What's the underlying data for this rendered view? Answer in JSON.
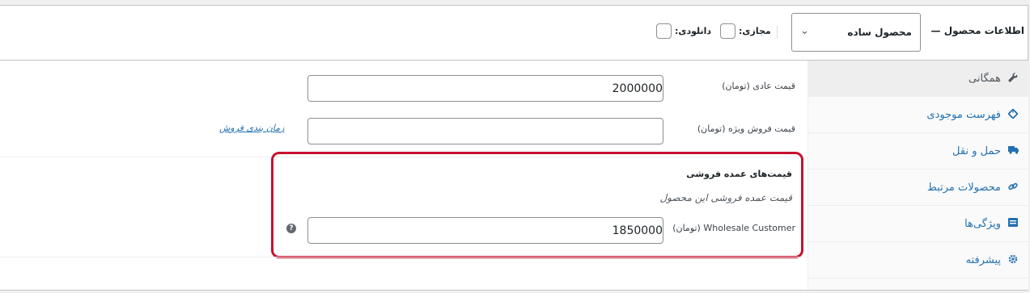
{
  "header": {
    "title": "اطلاعات محصول —",
    "product_type": "محصول ساده",
    "virtual_label": "مجازی:",
    "downloadable_label": "دانلودی:"
  },
  "tabs": [
    {
      "label": "همگانی",
      "icon": "wrench-icon",
      "active": true
    },
    {
      "label": "فهرست موجودی",
      "icon": "tag-icon",
      "active": false
    },
    {
      "label": "حمل و نقل",
      "icon": "truck-icon",
      "active": false
    },
    {
      "label": "محصولات مرتبط",
      "icon": "link-icon",
      "active": false
    },
    {
      "label": "ویژگی‌ها",
      "icon": "list-icon",
      "active": false
    },
    {
      "label": "پیشرفته",
      "icon": "gear-icon",
      "active": false
    }
  ],
  "general": {
    "regular_price_label": "قیمت عادی (تومان)",
    "regular_price_value": "2000000",
    "sale_price_label": "قیمت فروش ویژه (تومان)",
    "sale_price_value": "",
    "schedule_link": "زمان بندی فروش"
  },
  "wholesale": {
    "title": "قیمت‌های عمده فروشی",
    "description": "قیمت عمده فروشی این محصول",
    "customer_label": "Wholesale Customer (تومان)",
    "customer_value": "1850000",
    "help_glyph": "?"
  },
  "colors": {
    "highlight": "#c8102e",
    "link": "#2271b1"
  }
}
